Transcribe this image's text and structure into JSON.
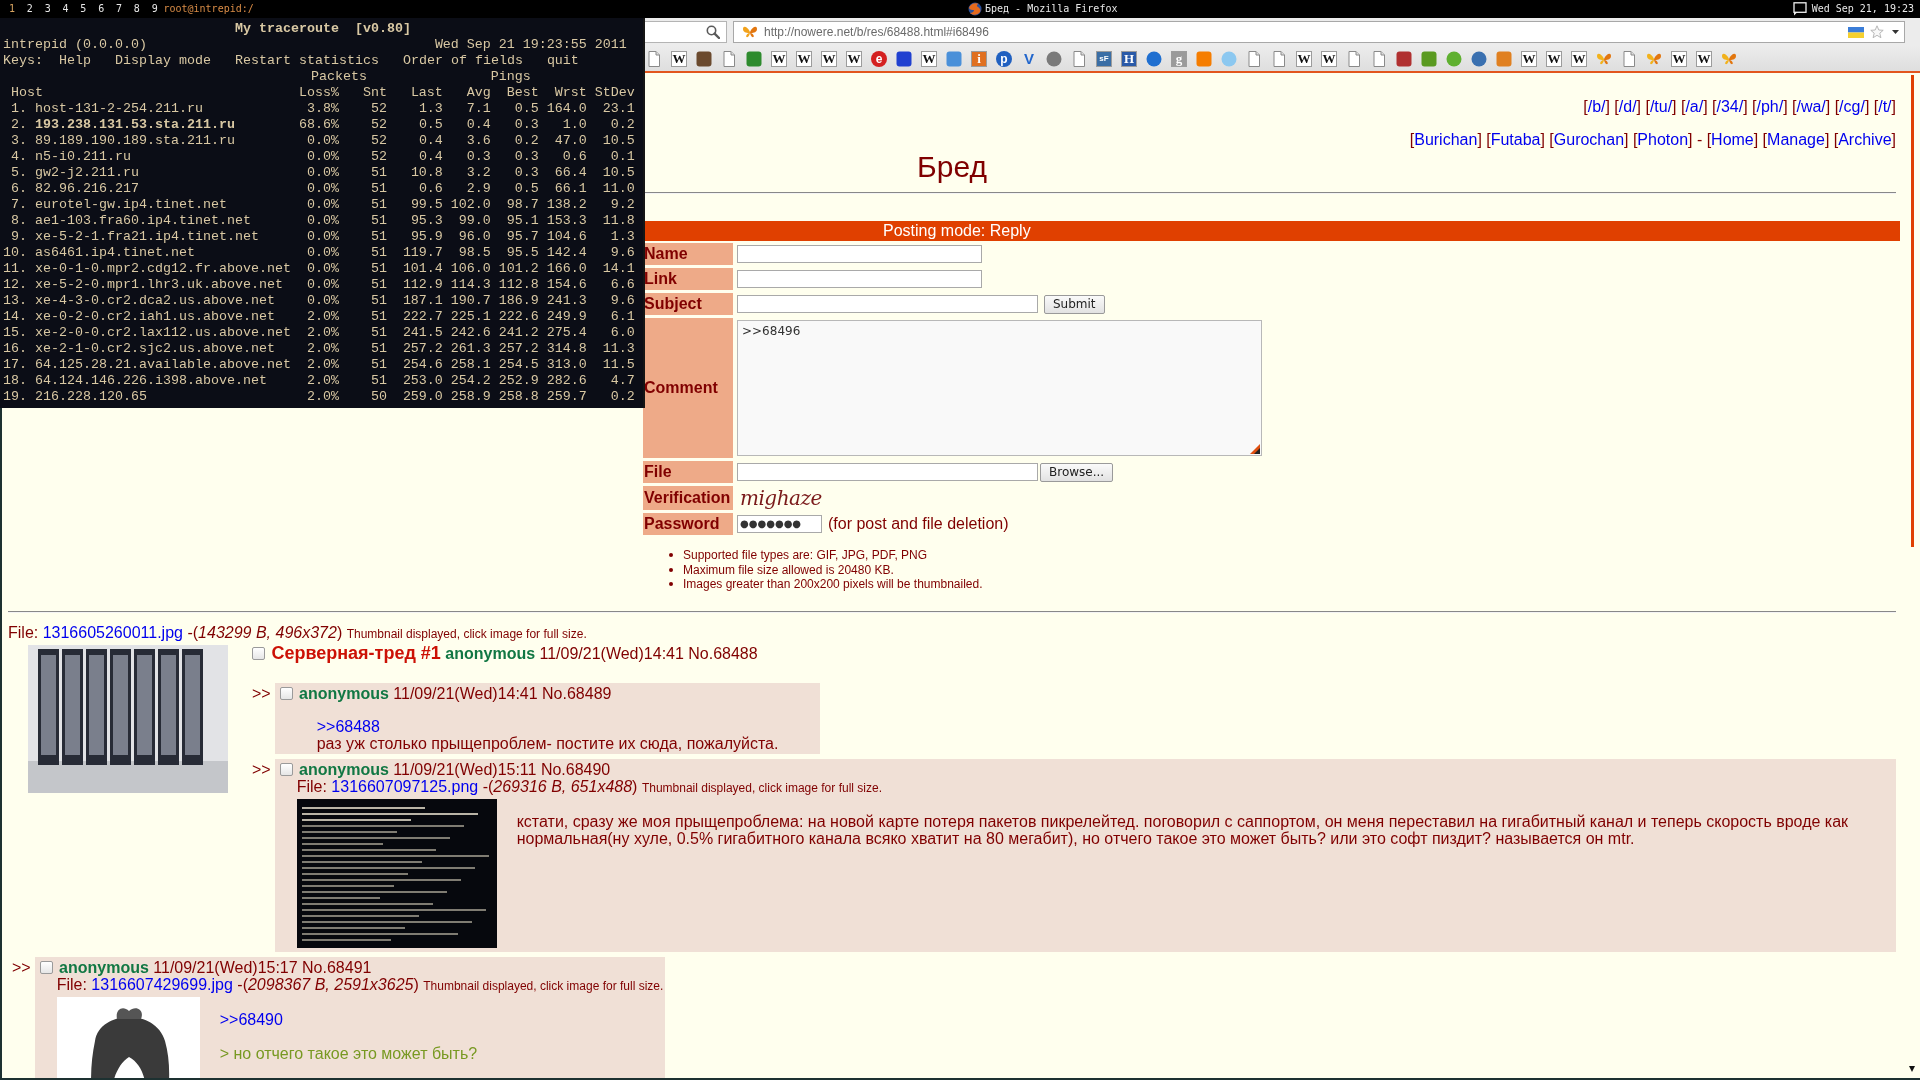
{
  "top_bar": {
    "tags": [
      {
        "label": "1",
        "selected": true
      },
      {
        "label": "2",
        "selected": false
      },
      {
        "label": "3",
        "selected": false
      },
      {
        "label": "4",
        "selected": false
      },
      {
        "label": "5",
        "selected": false
      },
      {
        "label": "6",
        "selected": false
      },
      {
        "label": "7",
        "selected": false
      },
      {
        "label": "8",
        "selected": false
      },
      {
        "label": "9",
        "selected": false
      }
    ],
    "window_name": "root@intrepid:/",
    "title": "Бред - Mozilla Firefox",
    "clock": "Wed Sep 21, 19:23"
  },
  "terminal": {
    "title": "My traceroute  [v0.80]",
    "host": "intrepid (0.0.0.0)",
    "time": "Wed Sep 21 19:23:55 2011",
    "keys_label": "Keys:",
    "menu": [
      "Help",
      "Display mode",
      "Restart statistics",
      "Order of fields",
      "quit"
    ],
    "groups": [
      "Packets",
      "Pings"
    ],
    "columns": [
      "Host",
      "Loss%",
      "Snt",
      "Last",
      "Avg",
      "Best",
      "Wrst",
      "StDev"
    ],
    "rows": [
      {
        "number": "1.",
        "host": "host-131-2-254.211.ru",
        "bold": false,
        "values": [
          "3.8%",
          "52",
          "1.3",
          "7.1",
          "0.5",
          "164.0",
          "23.1"
        ]
      },
      {
        "number": "2.",
        "host": "193.238.131.53.sta.211.ru",
        "bold": true,
        "values": [
          "68.6%",
          "52",
          "0.5",
          "0.4",
          "0.3",
          "1.0",
          "0.2"
        ]
      },
      {
        "number": "3.",
        "host": "89.189.190.189.sta.211.ru",
        "bold": false,
        "values": [
          "0.0%",
          "52",
          "0.4",
          "3.6",
          "0.2",
          "47.0",
          "10.5"
        ]
      },
      {
        "number": "4.",
        "host": "n5-i0.211.ru",
        "bold": false,
        "values": [
          "0.0%",
          "52",
          "0.4",
          "0.3",
          "0.3",
          "0.6",
          "0.1"
        ]
      },
      {
        "number": "5.",
        "host": "gw2-j2.211.ru",
        "bold": false,
        "values": [
          "0.0%",
          "51",
          "10.8",
          "3.2",
          "0.3",
          "66.4",
          "10.5"
        ]
      },
      {
        "number": "6.",
        "host": "82.96.216.217",
        "bold": false,
        "values": [
          "0.0%",
          "51",
          "0.6",
          "2.9",
          "0.5",
          "66.1",
          "11.0"
        ]
      },
      {
        "number": "7.",
        "host": "eurotel-gw.ip4.tinet.net",
        "bold": false,
        "values": [
          "0.0%",
          "51",
          "99.5",
          "102.0",
          "98.7",
          "138.2",
          "9.2"
        ]
      },
      {
        "number": "8.",
        "host": "ae1-103.fra60.ip4.tinet.net",
        "bold": false,
        "values": [
          "0.0%",
          "51",
          "95.3",
          "99.0",
          "95.1",
          "153.3",
          "11.8"
        ]
      },
      {
        "number": "9.",
        "host": "xe-5-2-1.fra21.ip4.tinet.net",
        "bold": false,
        "values": [
          "0.0%",
          "51",
          "95.9",
          "96.0",
          "95.7",
          "104.6",
          "1.3"
        ]
      },
      {
        "number": "10.",
        "host": "as6461.ip4.tinet.net",
        "bold": false,
        "values": [
          "0.0%",
          "51",
          "119.7",
          "98.5",
          "95.5",
          "142.4",
          "9.6"
        ]
      },
      {
        "number": "11.",
        "host": "xe-0-1-0.mpr2.cdg12.fr.above.net",
        "bold": false,
        "values": [
          "0.0%",
          "51",
          "101.4",
          "106.0",
          "101.2",
          "166.0",
          "14.1"
        ]
      },
      {
        "number": "12.",
        "host": "xe-5-2-0.mpr1.lhr3.uk.above.net",
        "bold": false,
        "values": [
          "0.0%",
          "51",
          "112.9",
          "114.3",
          "112.8",
          "154.6",
          "6.6"
        ]
      },
      {
        "number": "13.",
        "host": "xe-4-3-0.cr2.dca2.us.above.net",
        "bold": false,
        "values": [
          "0.0%",
          "51",
          "187.1",
          "190.7",
          "186.9",
          "241.3",
          "9.6"
        ]
      },
      {
        "number": "14.",
        "host": "xe-0-2-0.cr2.iah1.us.above.net",
        "bold": false,
        "values": [
          "2.0%",
          "51",
          "222.7",
          "225.1",
          "222.6",
          "249.9",
          "6.1"
        ]
      },
      {
        "number": "15.",
        "host": "xe-2-0-0.cr2.lax112.us.above.net",
        "bold": false,
        "values": [
          "2.0%",
          "51",
          "241.5",
          "242.6",
          "241.2",
          "275.4",
          "6.0"
        ]
      },
      {
        "number": "16.",
        "host": "xe-2-1-0.cr2.sjc2.us.above.net",
        "bold": false,
        "values": [
          "2.0%",
          "51",
          "257.2",
          "261.3",
          "257.2",
          "314.8",
          "11.3"
        ]
      },
      {
        "number": "17.",
        "host": "64.125.28.21.available.above.net",
        "bold": false,
        "values": [
          "2.0%",
          "51",
          "254.6",
          "258.1",
          "254.5",
          "313.0",
          "11.5"
        ]
      },
      {
        "number": "18.",
        "host": "64.124.146.226.i398.above.net",
        "bold": false,
        "values": [
          "2.0%",
          "51",
          "253.0",
          "254.2",
          "252.9",
          "282.6",
          "4.7"
        ]
      },
      {
        "number": "19.",
        "host": "216.228.120.65",
        "bold": false,
        "values": [
          "2.0%",
          "50",
          "259.0",
          "258.9",
          "258.8",
          "259.7",
          "0.2"
        ]
      }
    ]
  },
  "browser": {
    "url": "http://nowere.net/b/res/68488.html#i68496",
    "bookmarks": [
      {
        "kind": "page"
      },
      {
        "kind": "tile",
        "text": "W",
        "color": "#ffffff"
      },
      {
        "kind": "mark",
        "color": "#6b4a2e"
      },
      {
        "kind": "page"
      },
      {
        "kind": "mark",
        "color": "#2e8b2e"
      },
      {
        "kind": "tile",
        "text": "W",
        "color": "#ffffff"
      },
      {
        "kind": "tile",
        "text": "W",
        "color": "#ffffff"
      },
      {
        "kind": "tile",
        "text": "W",
        "color": "#ffffff"
      },
      {
        "kind": "tile",
        "text": "W",
        "color": "#ffffff"
      },
      {
        "kind": "disc",
        "text": "e",
        "color": "#d42020"
      },
      {
        "kind": "mark",
        "color": "#2040d0"
      },
      {
        "kind": "tile",
        "text": "W",
        "color": "#ffffff"
      },
      {
        "kind": "mark",
        "color": "#4a90d9"
      },
      {
        "kind": "tile",
        "text": "i",
        "color": "#e07020"
      },
      {
        "kind": "disc",
        "text": "p",
        "color": "#2060c0"
      },
      {
        "kind": "glyph",
        "text": "V",
        "color": "#2266cc"
      },
      {
        "kind": "dot",
        "color": "#7a7a7a"
      },
      {
        "kind": "page"
      },
      {
        "kind": "tile",
        "text": "sF",
        "color": "#3a6ea5"
      },
      {
        "kind": "tile",
        "text": "H",
        "color": "#2a5aa8"
      },
      {
        "kind": "dot",
        "color": "#1f6fd0"
      },
      {
        "kind": "tile",
        "text": "g",
        "color": "#9a9a9a"
      },
      {
        "kind": "mark",
        "color": "#f57d00"
      },
      {
        "kind": "dot",
        "color": "#8cc8f0"
      },
      {
        "kind": "page"
      },
      {
        "kind": "page"
      },
      {
        "kind": "tile",
        "text": "W",
        "color": "#ffffff"
      },
      {
        "kind": "tile",
        "text": "W",
        "color": "#ffffff"
      },
      {
        "kind": "page"
      },
      {
        "kind": "page"
      },
      {
        "kind": "mark",
        "color": "#b03030"
      },
      {
        "kind": "mark",
        "color": "#5a9a20"
      },
      {
        "kind": "dot",
        "color": "#5fb030"
      },
      {
        "kind": "dot",
        "color": "#3a70b0"
      },
      {
        "kind": "mark",
        "color": "#e08020"
      },
      {
        "kind": "tile",
        "text": "W",
        "color": "#ffffff"
      },
      {
        "kind": "tile",
        "text": "W",
        "color": "#ffffff"
      },
      {
        "kind": "tile",
        "text": "W",
        "color": "#ffffff"
      },
      {
        "kind": "butterfly"
      },
      {
        "kind": "page"
      },
      {
        "kind": "butterfly"
      },
      {
        "kind": "tile",
        "text": "W",
        "color": "#ffffff"
      },
      {
        "kind": "tile",
        "text": "W",
        "color": "#ffffff"
      },
      {
        "kind": "butterfly"
      }
    ]
  },
  "page": {
    "board_nav": [
      {
        "open": "[",
        "label": "/b/",
        "close": "]"
      },
      {
        "open": "[",
        "label": "/d/",
        "close": "]"
      },
      {
        "open": "[",
        "label": "/tu/",
        "close": "]"
      },
      {
        "open": "[",
        "label": "/a/",
        "close": "]"
      },
      {
        "open": "[",
        "label": "/34/",
        "close": "]"
      },
      {
        "open": "[",
        "label": "/ph/",
        "close": "]"
      },
      {
        "open": "[",
        "label": "/wa/",
        "close": "]"
      },
      {
        "open": "[",
        "label": "/cg/",
        "close": "]"
      },
      {
        "open": "[",
        "label": "/t/",
        "close": "]"
      }
    ],
    "style_nav": [
      {
        "kind": "link",
        "open": "[",
        "label": "Burichan",
        "close": "]"
      },
      {
        "kind": "link",
        "open": "[",
        "label": "Futaba",
        "close": "]"
      },
      {
        "kind": "link",
        "open": "[",
        "label": "Gurochan",
        "close": "]"
      },
      {
        "kind": "link",
        "open": "[",
        "label": "Photon",
        "close": "]"
      },
      {
        "kind": "separator",
        "text": "-"
      },
      {
        "kind": "link",
        "open": "[",
        "label": "Home",
        "close": "]"
      },
      {
        "kind": "link",
        "open": "[",
        "label": "Manage",
        "close": "]"
      },
      {
        "kind": "link",
        "open": "[",
        "label": "Archive",
        "close": "]"
      }
    ],
    "title": "Бред",
    "posting_mode": "Posting mode: Reply",
    "form": {
      "rows": [
        {
          "kind": "input",
          "label": "Name"
        },
        {
          "kind": "input",
          "label": "Link"
        },
        {
          "kind": "input_button",
          "label": "Subject",
          "button": "Submit"
        },
        {
          "kind": "textarea",
          "label": "Comment",
          "value": ">>68496"
        },
        {
          "kind": "file",
          "label": "File",
          "button": "Browse..."
        },
        {
          "kind": "captcha",
          "label": "Verification",
          "captcha": "mighaze"
        },
        {
          "kind": "password",
          "label": "Password",
          "value": "●●●●●●●",
          "note": "(for post and file deletion)"
        }
      ],
      "rules": [
        "Supported file types are: GIF, JPG, PDF, PNG",
        "Maximum file size allowed is 20480 KB.",
        "Images greater than 200x200 pixels will be thumbnailed."
      ]
    }
  },
  "thread": {
    "op": {
      "file": {
        "label": "File:",
        "name": "1316605260011.jpg",
        "meta": "-(*143299 B, 496x372*)",
        "note": "Thumbnail displayed, click image for full size."
      },
      "thumbnail": {
        "kind": "photo"
      },
      "checked": false,
      "subject": "Серверная-тред #1",
      "name": "anonymous",
      "date": "11/09/21(Wed)14:41",
      "number": "No.68488"
    },
    "replies": [
      {
        "marker": ">>",
        "checked": false,
        "name": "anonymous",
        "date": "11/09/21(Wed)14:41",
        "number": "No.68489",
        "paragraphs": [
          [
            {
              "kind": "reference",
              "text": ">>68488"
            },
            {
              "kind": "text",
              "text": "раз уж столько прыщепроблем- постите их сюда, пожалуйста."
            }
          ]
        ]
      },
      {
        "marker": ">>",
        "checked": false,
        "name": "anonymous",
        "date": "11/09/21(Wed)15:11",
        "number": "No.68490",
        "file": {
          "label": "File:",
          "name": "1316607097125.png",
          "meta": "-(*269316 B, 651x488*)",
          "note": "Thumbnail displayed, click image for full size."
        },
        "thumbnail": {
          "kind": "screenshot"
        },
        "paragraphs": [
          [
            {
              "kind": "text",
              "text": "кстати, сразу же моя прыщепроблема: на новой карте потеря пакетов пикрелейтед. поговорил с саппортом, он меня переставил на гигабитный канал и теперь скорость вроде как нормальная(ну хуле, 0.5% гигабитного канала всяко хватит на 80 мегабит), но отчего такое это может быть? или это софт пиздит? называется он mtr."
            }
          ]
        ]
      },
      {
        "marker": ">>",
        "checked": false,
        "name": "anonymous",
        "date": "11/09/21(Wed)15:17",
        "number": "No.68491",
        "file": {
          "label": "File:",
          "name": "1316607429699.jpg",
          "meta": "-(*2098367 B, 2591x3625*)",
          "note": "Thumbnail displayed, click image for full size."
        },
        "thumbnail": {
          "kind": "illustration"
        },
        "paragraphs": [
          [
            {
              "kind": "reference",
              "text": ">>68490"
            }
          ],
          [
            {
              "kind": "quote",
              "text": "> но отчего такое это может быть?"
            }
          ]
        ]
      }
    ]
  }
}
